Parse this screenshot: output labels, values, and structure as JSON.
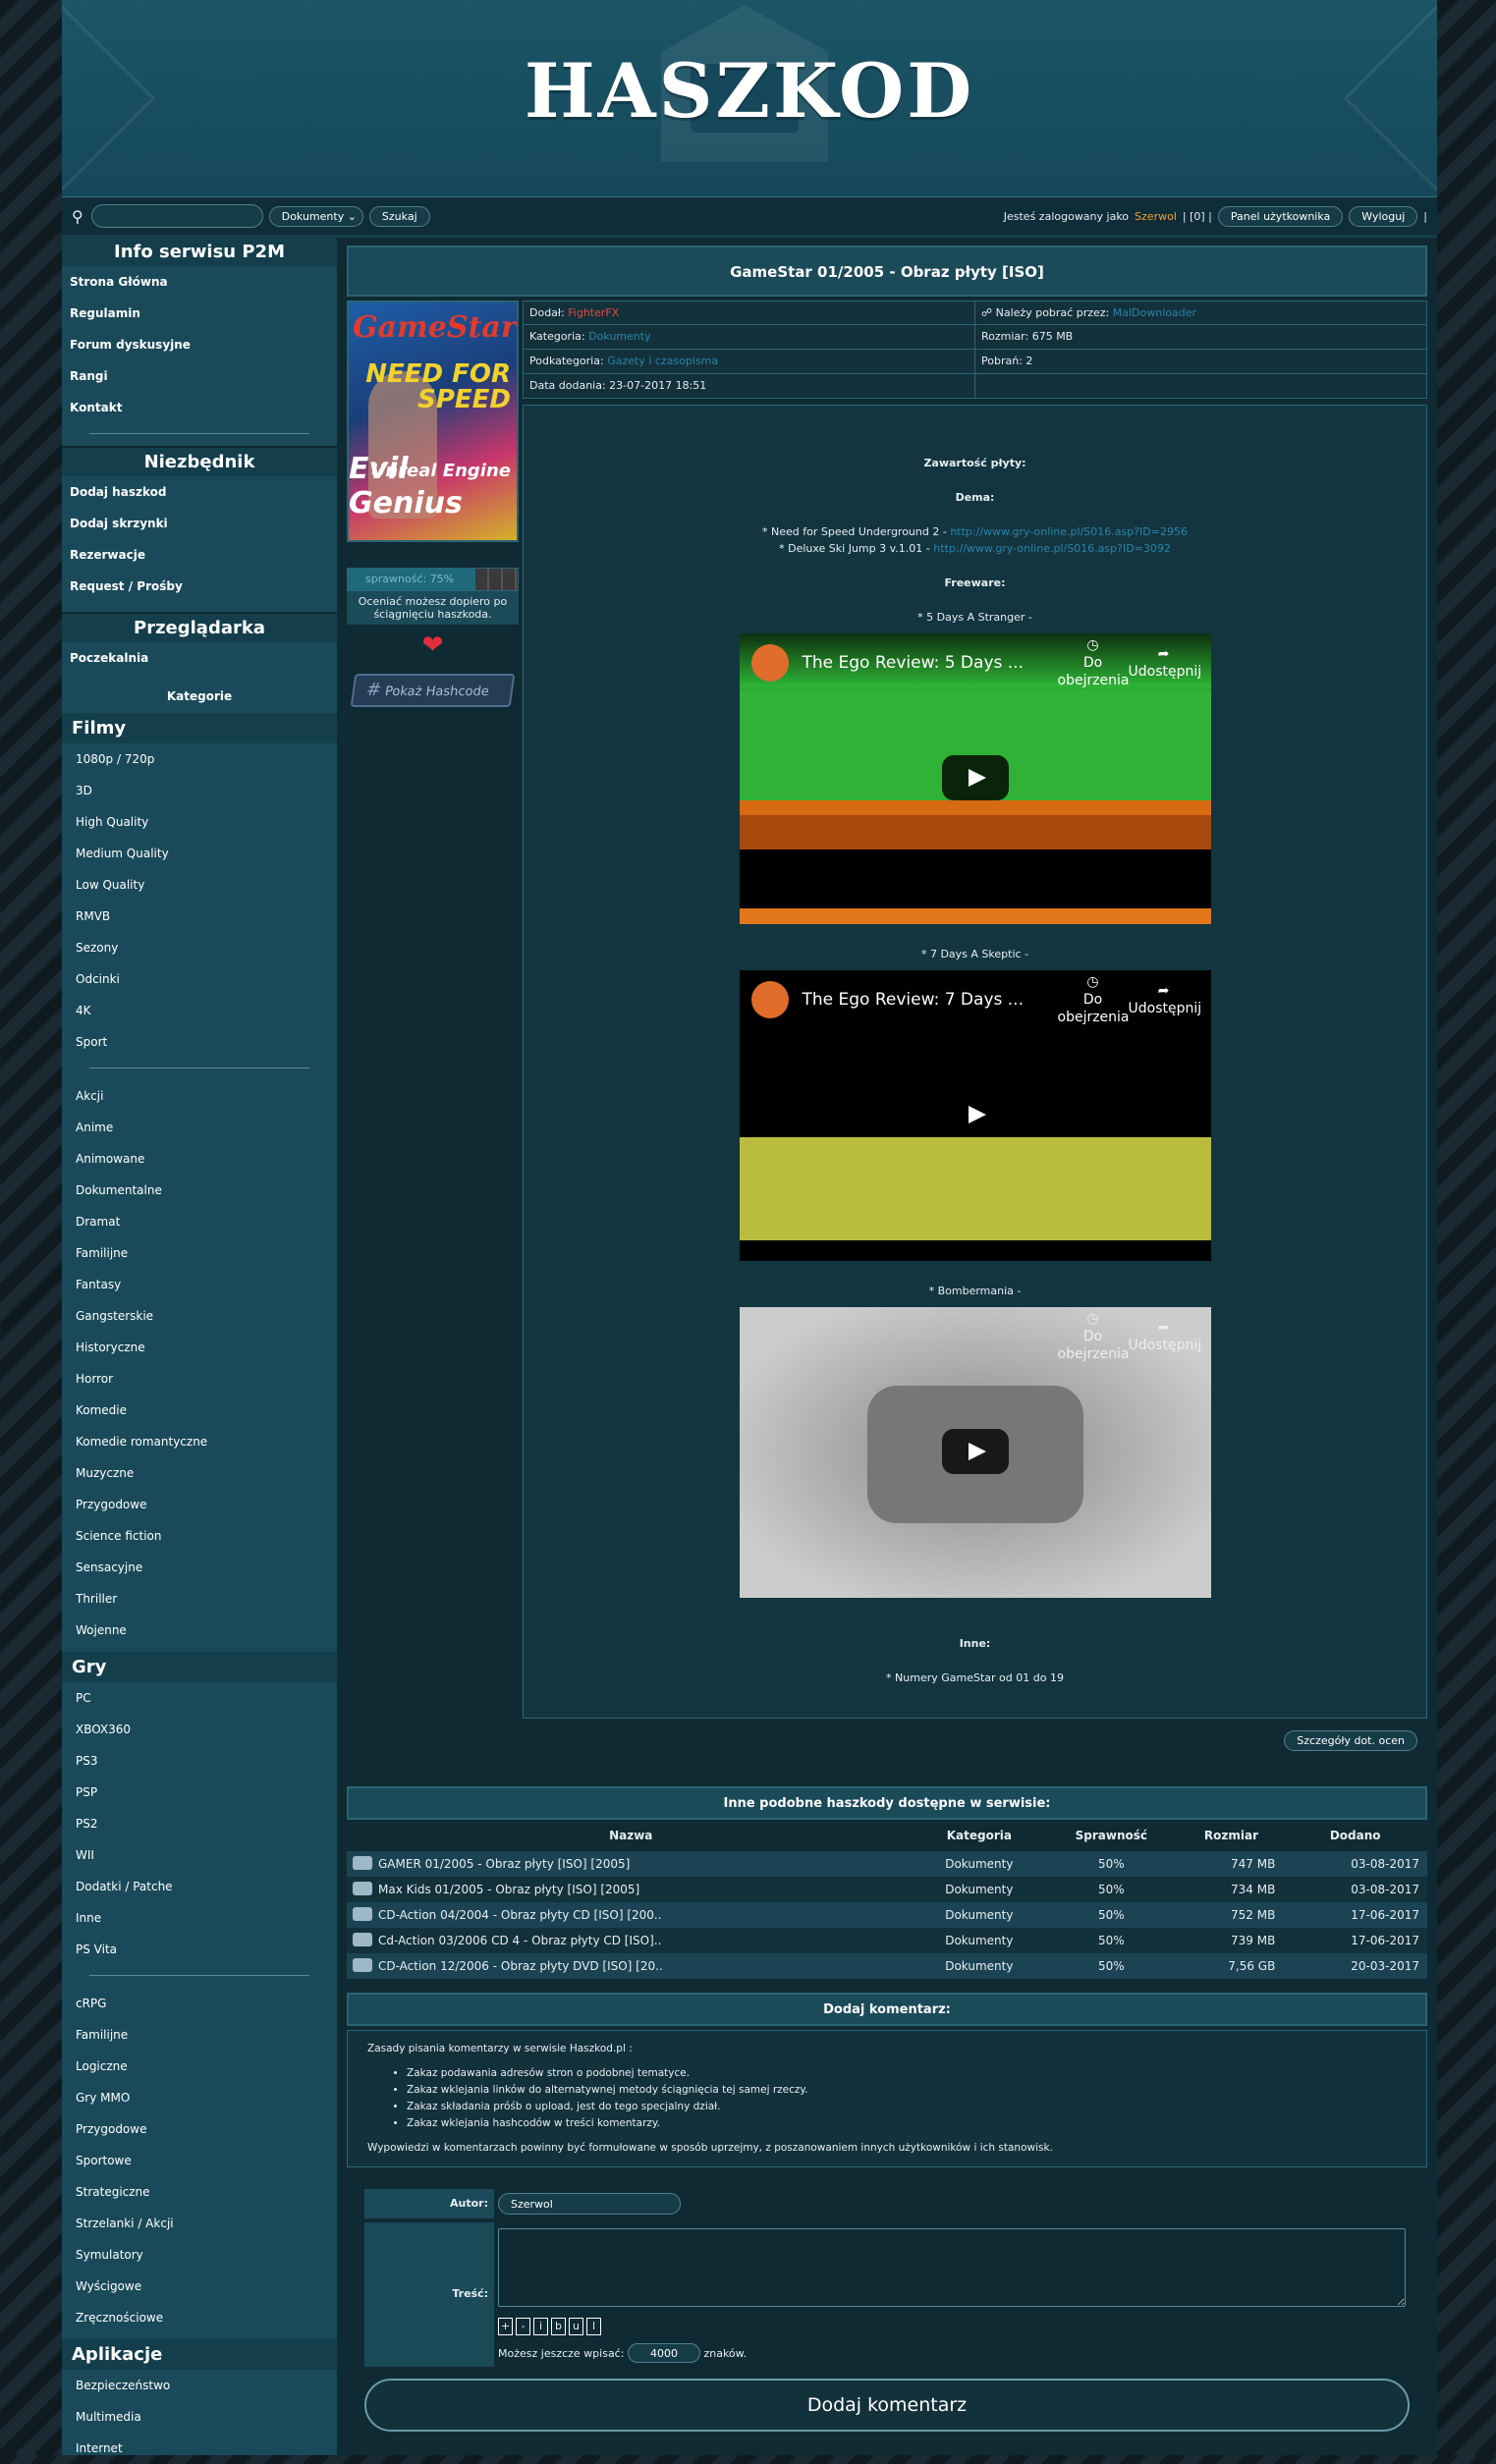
{
  "site": {
    "logo": "HASZKOD"
  },
  "topbar": {
    "search_placeholder": "",
    "category": "Dokumenty",
    "search_button": "Szukaj",
    "logged_prefix": "Jesteś zalogowany jako",
    "user": "Szerwol",
    "counter": "| [0] |",
    "panel": "Panel użytkownika",
    "logout": "Wyloguj",
    "end": "|"
  },
  "sidebar": {
    "info_title": "Info serwisu P2M",
    "info_items": [
      "Strona Główna",
      "Regulamin",
      "Forum dyskusyjne",
      "Rangi",
      "Kontakt"
    ],
    "need_title": "Niezbędnik",
    "need_items": [
      "Dodaj haszkod",
      "Dodaj skrzynki",
      "Rezerwacje",
      "Request / Prośby"
    ],
    "browse_title": "Przeglądarka",
    "browse_items": [
      "Poczekalnia"
    ],
    "categories_label": "Kategorie",
    "films_title": "Filmy",
    "films_quality": [
      "1080p / 720p",
      "3D",
      "High Quality",
      "Medium Quality",
      "Low Quality",
      "RMVB",
      "Sezony",
      "Odcinki",
      "4K",
      "Sport"
    ],
    "films_genres": [
      "Akcji",
      "Anime",
      "Animowane",
      "Dokumentalne",
      "Dramat",
      "Familijne",
      "Fantasy",
      "Gangsterskie",
      "Historyczne",
      "Horror",
      "Komedie",
      "Komedie romantyczne",
      "Muzyczne",
      "Przygodowe",
      "Science fiction",
      "Sensacyjne",
      "Thriller",
      "Wojenne"
    ],
    "games_title": "Gry",
    "games_platforms": [
      "PC",
      "XBOX360",
      "PS3",
      "PSP",
      "PS2",
      "WII",
      "Dodatki / Patche",
      "Inne",
      "PS Vita"
    ],
    "games_genres": [
      "cRPG",
      "Familijne",
      "Logiczne",
      "Gry MMO",
      "Przygodowe",
      "Sportowe",
      "Strategiczne",
      "Strzelanki / Akcji",
      "Symulatory",
      "Wyścigowe",
      "Zręcznościowe"
    ],
    "apps_title": "Aplikacje",
    "apps_items": [
      "Bezpieczeństwo",
      "Multimedia",
      "Internet"
    ]
  },
  "item": {
    "title": "GameStar 01/2005 - Obraz płyty [ISO]",
    "cover": {
      "t1": "GameStar",
      "t2": "NEED FOR SPEED",
      "t3": "Unreal Engine",
      "t4": "Evil Genius"
    },
    "rating_label": "sprawność: 75%",
    "rating_value": 0.75,
    "rating_note": "Oceniać możesz dopiero po ściągnięciu haszkoda.",
    "hash_button": "Pokaż Hashcode",
    "added_by_label": "Dodał:",
    "added_by": "FighterFX",
    "download_label": "Należy pobrać przez:",
    "download_via": "MalDownloader",
    "category_label": "Kategoria:",
    "category": "Dokumenty",
    "size_label": "Rozmiar:",
    "size": "675 MB",
    "subcategory_label": "Podkategoria:",
    "subcategory": "Gazety i czasopisma",
    "downloads_label": "Pobrań:",
    "downloads": "2",
    "date_label": "Data dodania:",
    "date": "23-07-2017 18:51"
  },
  "desc": {
    "contents": "Zawartość płyty:",
    "demos": "Dema:",
    "demo1": "* Need for Speed Underground 2 - ",
    "demo1_link": "http://www.gry-online.pl/S016.asp?ID=2956",
    "demo2": "* Deluxe Ski Jump 3 v.1.01 - ",
    "demo2_link": "http://www.gry-online.pl/S016.asp?ID=3092",
    "freeware": "Freeware:",
    "fw1": "* 5 Days A Stranger -",
    "fw2": "* 7 Days A Skeptic -",
    "fw3": "* Bombermania -",
    "other": "Inne:",
    "other1": "* Numery GameStar od 01 do 19",
    "videos": [
      {
        "title": "The Ego Review: 5 Days ...",
        "watch": "Do obejrzenia",
        "share": "Udostępnij"
      },
      {
        "title": "The Ego Review: 7 Days ...",
        "watch": "Do obejrzenia",
        "share": "Udostępnij"
      },
      {
        "title": "",
        "watch": "Do obejrzenia",
        "share": "Udostępnij"
      }
    ]
  },
  "details_button": "Szczegóły dot. ocen",
  "similar": {
    "title": "Inne podobne haszkody dostępne w serwisie:",
    "headers": [
      "Nazwa",
      "Kategoria",
      "Sprawność",
      "Rozmiar",
      "Dodano"
    ],
    "rows": [
      [
        "GAMER 01/2005 - Obraz płyty [ISO] [2005]",
        "Dokumenty",
        "50%",
        "747 MB",
        "03-08-2017"
      ],
      [
        "Max Kids 01/2005 - Obraz płyty [ISO] [2005]",
        "Dokumenty",
        "50%",
        "734 MB",
        "03-08-2017"
      ],
      [
        "CD-Action 04/2004 - Obraz płyty CD [ISO] [200..",
        "Dokumenty",
        "50%",
        "752 MB",
        "17-06-2017"
      ],
      [
        "Cd-Action 03/2006 CD 4 - Obraz płyty CD [ISO]..",
        "Dokumenty",
        "50%",
        "739 MB",
        "17-06-2017"
      ],
      [
        "CD-Action 12/2006 - Obraz płyty DVD [ISO] [20..",
        "Dokumenty",
        "50%",
        "7,56 GB",
        "20-03-2017"
      ]
    ]
  },
  "comments": {
    "title": "Dodaj komentarz:",
    "rules_intro": "Zasady pisania komentarzy w serwisie Haszkod.pl :",
    "rules": [
      "Zakaz podawania adresów stron o podobnej tematyce.",
      "Zakaz wklejania linków do alternatywnej metody ściągnięcia tej samej rzeczy.",
      "Zakaz składania próśb o upload, jest do tego specjalny dział.",
      "Zakaz wklejania hashcodów w treści komentarzy."
    ],
    "rules_outro": "Wypowiedzi w komentarzach powinny być formułowane w sposób uprzejmy, z poszanowaniem innych użytkowników i ich stanowisk.",
    "author_label": "Autor:",
    "author": "Szerwol",
    "content_label": "Treść:",
    "format": [
      "+",
      "-",
      "i",
      "b",
      "u",
      "l"
    ],
    "remaining_label": "Możesz jeszcze wpisać:",
    "remaining": "4000",
    "remaining_unit": "znaków.",
    "submit": "Dodaj komentarz"
  }
}
